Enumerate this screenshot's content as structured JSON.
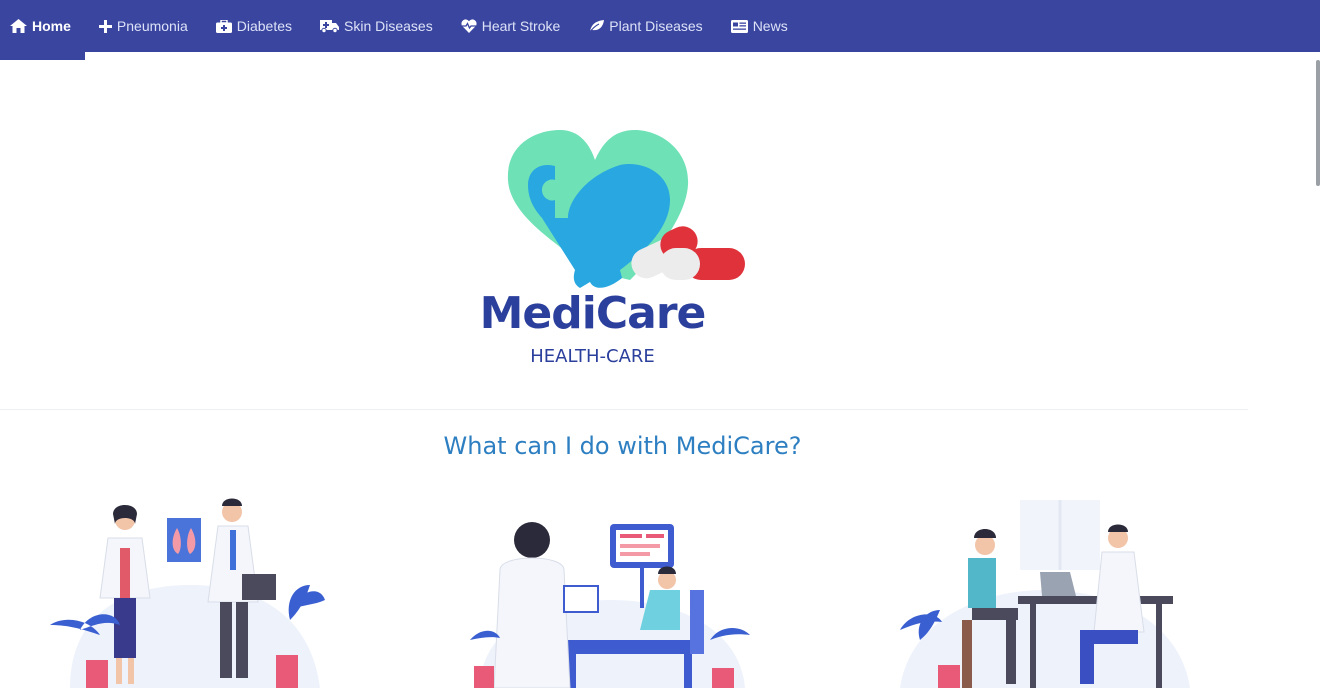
{
  "nav": {
    "items": [
      {
        "label": "Home",
        "icon": "home-icon",
        "active": true
      },
      {
        "label": "Pneumonia",
        "icon": "plus-icon"
      },
      {
        "label": "Diabetes",
        "icon": "medkit-icon"
      },
      {
        "label": "Skin Diseases",
        "icon": "ambulance-icon"
      },
      {
        "label": "Heart Stroke",
        "icon": "heartbeat-icon"
      },
      {
        "label": "Plant Diseases",
        "icon": "leaf-icon"
      },
      {
        "label": "News",
        "icon": "newspaper-icon"
      }
    ]
  },
  "brand": {
    "name": "MediCare",
    "tagline": "HEALTH-CARE"
  },
  "section": {
    "heading": "What can I do with MediCare?"
  },
  "colors": {
    "navbar": "#3a45a0",
    "brand": "#2b3f9c",
    "heading": "#2d7fc1",
    "heart_green": "#6fe1b6",
    "heart_blue": "#29a7e0",
    "pill_red": "#e0323a"
  }
}
